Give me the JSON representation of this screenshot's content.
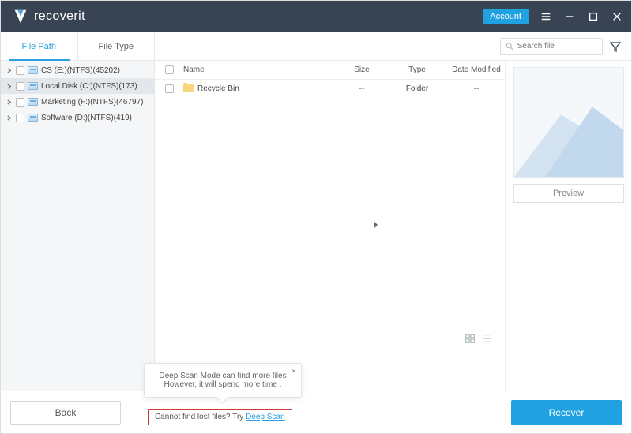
{
  "titlebar": {
    "brand": "recoverit",
    "account": "Account"
  },
  "tabs": {
    "path": "File Path",
    "type": "File Type"
  },
  "search": {
    "placeholder": "Search file"
  },
  "sidebar": {
    "items": [
      {
        "label": "CS (E:)(NTFS)(45202)"
      },
      {
        "label": "Local Disk (C:)(NTFS)(173)"
      },
      {
        "label": "Marketing (F:)(NTFS)(46797)"
      },
      {
        "label": "Software (D:)(NTFS)(419)"
      }
    ]
  },
  "columns": {
    "name": "Name",
    "size": "Size",
    "type": "Type",
    "date": "Date Modified"
  },
  "files": [
    {
      "name": "Recycle Bin",
      "size": "--",
      "type": "Folder",
      "date": "--"
    }
  ],
  "preview": {
    "button": "Preview"
  },
  "tooltip": {
    "line1": "Deep Scan Mode can find more files",
    "line2": "However, it will spend more time ."
  },
  "deeplink": {
    "prefix": "Cannot find lost files? Try ",
    "link": "Deep Scan"
  },
  "footer": {
    "back": "Back",
    "recover": "Recover"
  }
}
